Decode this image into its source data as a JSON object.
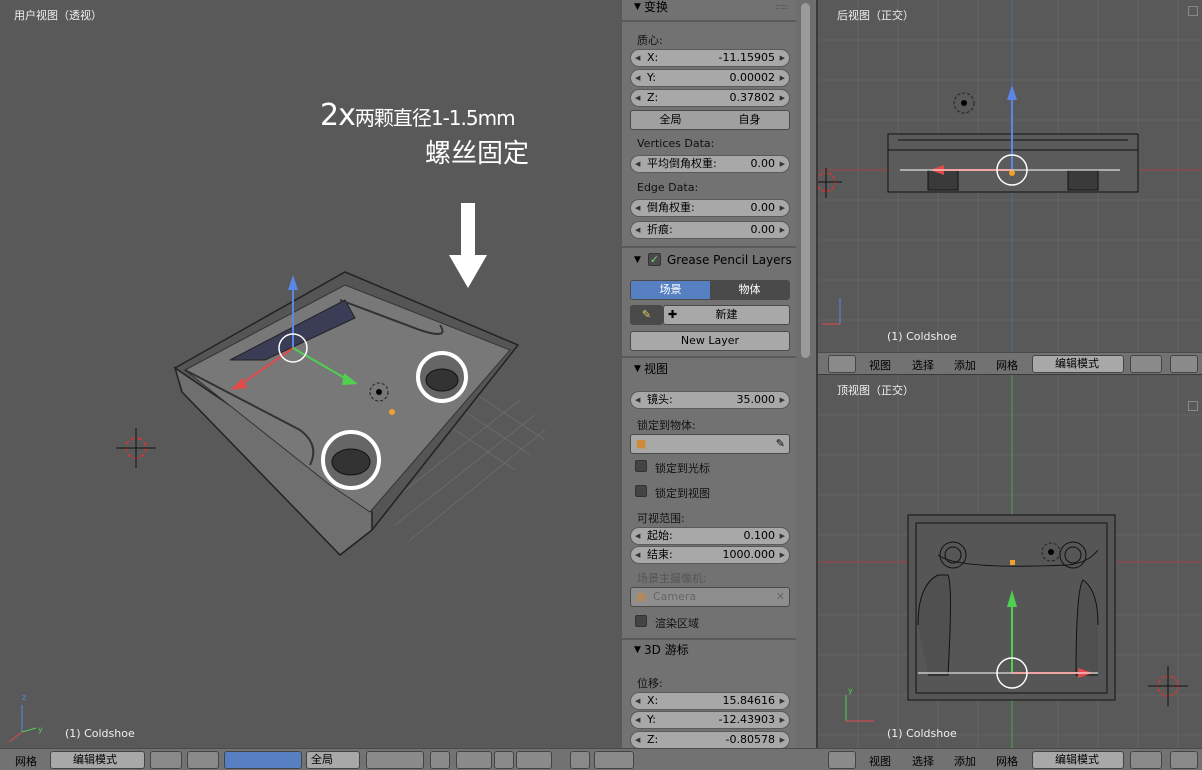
{
  "viewports": {
    "user": {
      "label": "用户视图（透视）",
      "object": "(1) Coldshoe"
    },
    "back": {
      "label": "后视图（正交）",
      "object": "(1) Coldshoe"
    },
    "top": {
      "label": "顶视图（正交）",
      "object": "(1) Coldshoe"
    }
  },
  "annotation": {
    "line1_prefix": "2x",
    "line1": "两颗直径1-1.5mm",
    "line2": "螺丝固定"
  },
  "panel": {
    "transform": {
      "title": "变换",
      "median_label": "质心:",
      "x_label": "X:",
      "x": "-11.15905",
      "y_label": "Y:",
      "y": "0.00002",
      "z_label": "Z:",
      "z": "0.37802",
      "global": "全局",
      "local": "自身",
      "vertices_data": "Vertices Data:",
      "mean_bevel_weight_label": "平均倒角权重:",
      "mean_bevel_weight": "0.00",
      "edge_data": "Edge Data:",
      "bevel_weight_label": "倒角权重:",
      "bevel_weight": "0.00",
      "crease_label": "折痕:",
      "crease": "0.00"
    },
    "grease": {
      "title": "Grease Pencil Layers",
      "scene": "场景",
      "object": "物体",
      "new": "新建",
      "new_layer": "New Layer"
    },
    "view": {
      "title": "视图",
      "lens_label": "镜头:",
      "lens": "35.000",
      "lock_object_label": "锁定到物体:",
      "lock_cursor": "锁定到光标",
      "lock_view": "锁定到视图",
      "clip_label": "可视范围:",
      "start_label": "起始:",
      "start": "0.100",
      "end_label": "结束:",
      "end": "1000.000",
      "scene_camera_label": "场景主摄像机:",
      "camera": "Camera",
      "render_border": "渲染区域"
    },
    "cursor": {
      "title": "3D 游标",
      "location_label": "位移:",
      "x_label": "X:",
      "x": "15.84616",
      "y_label": "Y:",
      "y": "-12.43903",
      "z_label": "Z:",
      "z": "-0.80578"
    }
  },
  "header_main": {
    "mesh": "网格",
    "mode": "编辑模式",
    "global": "全局"
  },
  "header_right": {
    "view": "视图",
    "select": "选择",
    "add": "添加",
    "mesh": "网格",
    "mode": "编辑模式"
  },
  "colors": {
    "viewport": "#595959",
    "panel": "#727272",
    "accent": "#5680c2"
  }
}
